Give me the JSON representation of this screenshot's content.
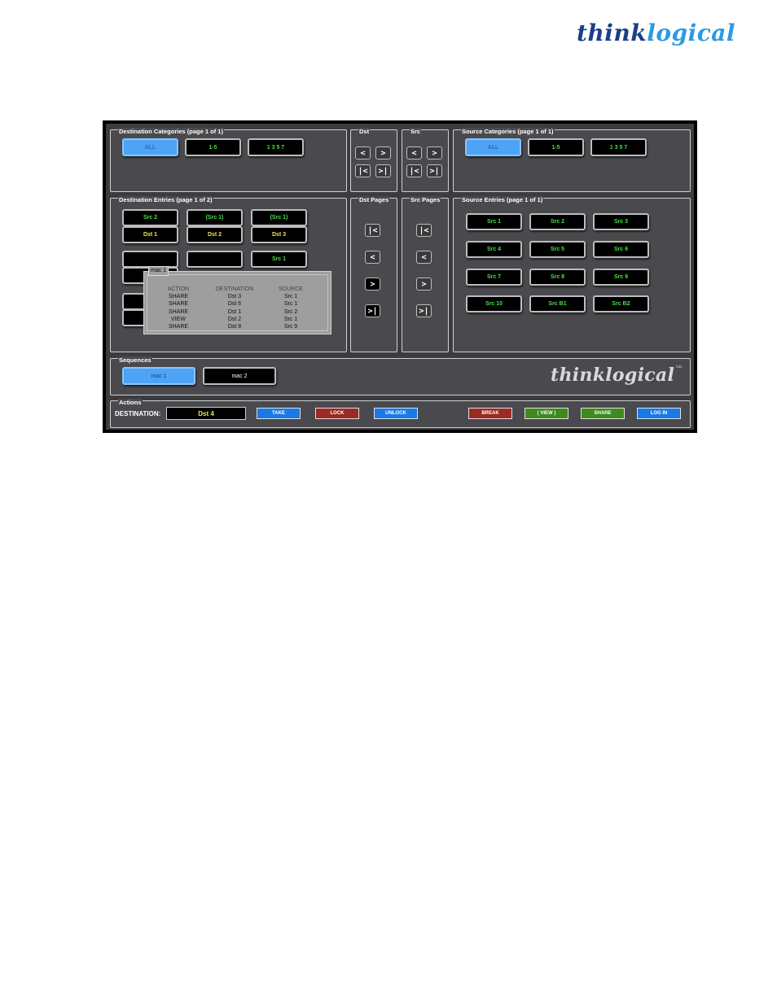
{
  "header_logo": {
    "part1": "think",
    "part2": "logical"
  },
  "panels": {
    "dest_categories": "Destination Categories (page 1 of 1)",
    "dst": "Dst",
    "src": "Src",
    "src_categories": "Source Categories (page 1 of 1)",
    "dest_entries": "Destination Entries (page 1 of 2)",
    "dst_pages": "Dst Pages",
    "src_pages": "Src Pages",
    "src_entries": "Source Entries (page 1 of 1)",
    "sequences": "Sequences",
    "actions": "Actions"
  },
  "categories": [
    "ALL",
    "1-5",
    "1 3 5 7"
  ],
  "nav": {
    "first": "|<",
    "prev": "<",
    "next": ">",
    "last": ">|"
  },
  "dest_entries": {
    "row1_src": [
      "Src 2",
      "(Src 1)",
      "(Src 1)"
    ],
    "row1_dst": [
      "Dst 1",
      "Dst 2",
      "Dst 3"
    ],
    "row2_src3": "Src 1"
  },
  "popup": {
    "tag": "mac 1",
    "headers": [
      "ACTION",
      "DESTINATION",
      "SOURCE"
    ],
    "rows": [
      [
        "SHARE",
        "Dst 3",
        "Src 1"
      ],
      [
        "SHARE",
        "Dst 6",
        "Src 1"
      ],
      [
        "SHARE",
        "Dst 1",
        "Src 2"
      ],
      [
        "VIEW",
        "Dst 2",
        "Src 1"
      ],
      [
        "SHARE",
        "Dst 8",
        "Src 9"
      ]
    ]
  },
  "source_entries": [
    "Src 1",
    "Src 2",
    "Src 3",
    "Src 4",
    "Src 5",
    "Src 6",
    "Src 7",
    "Src 8",
    "Src 9",
    "Src 10",
    "Src B1",
    "Src B2"
  ],
  "sequences": [
    "mac 1",
    "mac 2"
  ],
  "brand": "thinklogical",
  "brand_tm": "tm",
  "actions": {
    "destination_label": "DESTINATION:",
    "destination_value": "Dst 4",
    "take": "TAKE",
    "lock": "LOCK",
    "unlock": "UNLOCK",
    "break": "BREAK",
    "view": "( VIEW )",
    "share": "SHARE",
    "login": "LOG IN"
  },
  "colors": {
    "selected": "#4da3f5",
    "src_text": "#46e046",
    "dst_text": "#f2e64a",
    "take": "#1a7ae6",
    "lock": "#9b2a22",
    "share": "#3e8a1c"
  }
}
